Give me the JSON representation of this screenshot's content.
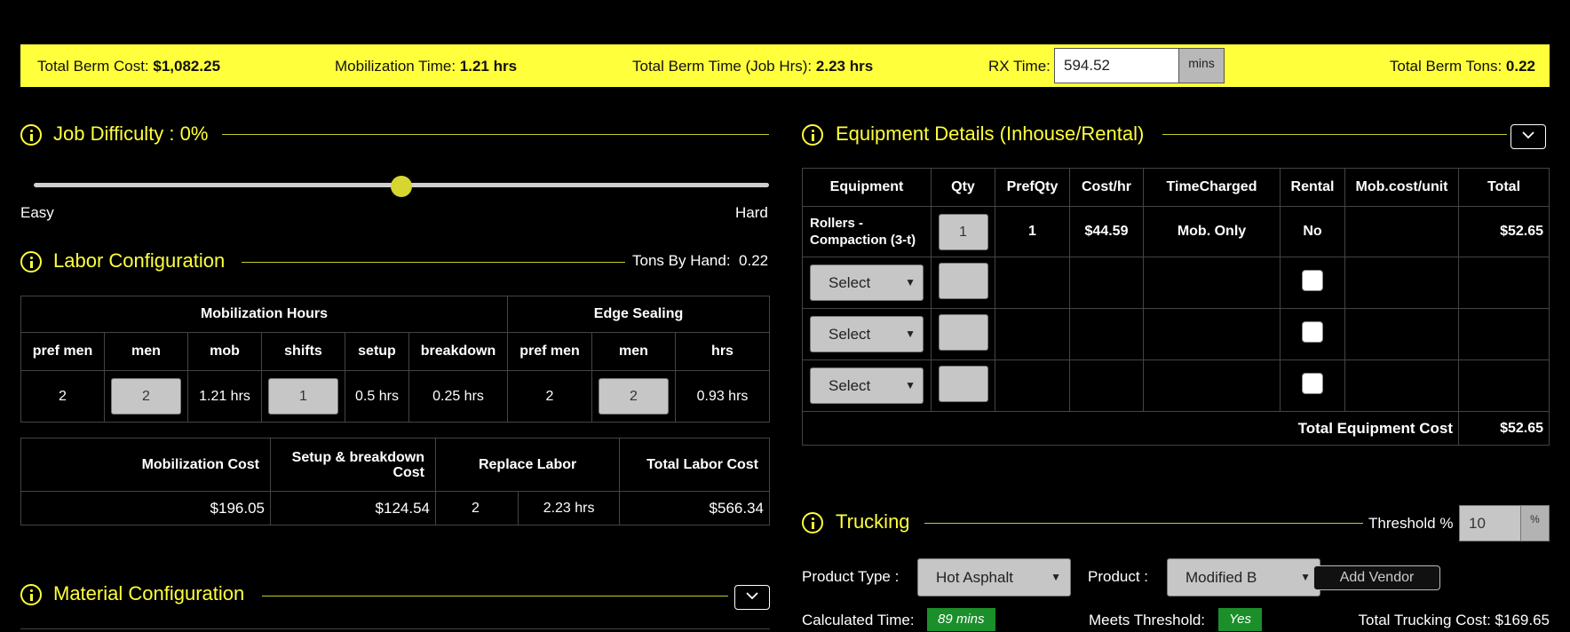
{
  "summary": {
    "total_berm_cost_label": "Total Berm Cost:",
    "total_berm_cost": "$1,082.25",
    "mobilization_time_label": "Mobilization Time:",
    "mobilization_time": "1.21 hrs",
    "total_berm_time_label": "Total Berm Time (Job Hrs):",
    "total_berm_time": "2.23 hrs",
    "rx_time_label": "RX Time:",
    "rx_time_value": "594.52",
    "rx_time_unit": "mins",
    "total_berm_tons_label": "Total Berm Tons:",
    "total_berm_tons": "0.22"
  },
  "job_difficulty": {
    "title": "Job Difficulty : 0%",
    "min_label": "Easy",
    "max_label": "Hard",
    "slider_level": 0.5
  },
  "labor": {
    "title": "Labor Configuration",
    "tons_by_hand_label": "Tons By Hand:",
    "tons_by_hand": "0.22",
    "group_mobilization": "Mobilization Hours",
    "group_edge": "Edge Sealing",
    "headers": [
      "pref men",
      "men",
      "mob",
      "shifts",
      "setup",
      "breakdown",
      "pref men",
      "men",
      "hrs"
    ],
    "row": {
      "pref_men": "2",
      "men": "2",
      "mob": "1.21 hrs",
      "shifts": "1",
      "setup": "0.5 hrs",
      "breakdown": "0.25 hrs",
      "edge_pref_men": "2",
      "edge_men": "2",
      "edge_hrs": "0.93 hrs"
    },
    "cost_headers": {
      "mobilization_cost": "Mobilization Cost",
      "setup_breakdown_cost": "Setup & breakdown Cost",
      "replace_labor": "Replace Labor",
      "total_labor_cost": "Total Labor Cost"
    },
    "cost_row": {
      "mobilization_cost": "$196.05",
      "setup_breakdown_cost": "$124.54",
      "replace_men": "2",
      "replace_hrs": "2.23 hrs",
      "total_labor_cost": "$566.34"
    }
  },
  "material": {
    "title": "Material Configuration"
  },
  "equipment": {
    "title": "Equipment Details (Inhouse/Rental)",
    "headers": [
      "Equipment",
      "Qty",
      "PrefQty",
      "Cost/hr",
      "TimeCharged",
      "Rental",
      "Mob.cost/unit",
      "Total"
    ],
    "row1": {
      "equipment": "Rollers - Compaction (3-t)",
      "qty": "1",
      "pref_qty": "1",
      "cost_hr": "$44.59",
      "time_charged": "Mob. Only",
      "rental": "No",
      "mob_cost": "",
      "total": "$52.65"
    },
    "select_placeholder": "Select",
    "total_label": "Total Equipment Cost",
    "total_value": "$52.65"
  },
  "trucking": {
    "title": "Trucking",
    "threshold_label": "Threshold %",
    "threshold_value": "10",
    "threshold_unit": "%",
    "product_type_label": "Product Type :",
    "product_type_value": "Hot Asphalt",
    "product_label": "Product :",
    "product_value": "Modified B",
    "add_vendor_label": "Add Vendor",
    "calculated_time_label": "Calculated Time:",
    "calculated_time_value": "89 mins",
    "meets_threshold_label": "Meets Threshold:",
    "meets_threshold_value": "Yes",
    "total_trucking_cost": "Total Trucking Cost: $169.65"
  },
  "colors": {
    "accent": "#ffff3c",
    "badge_green": "#1a8f2a",
    "input_gray": "#c6c6c6"
  }
}
